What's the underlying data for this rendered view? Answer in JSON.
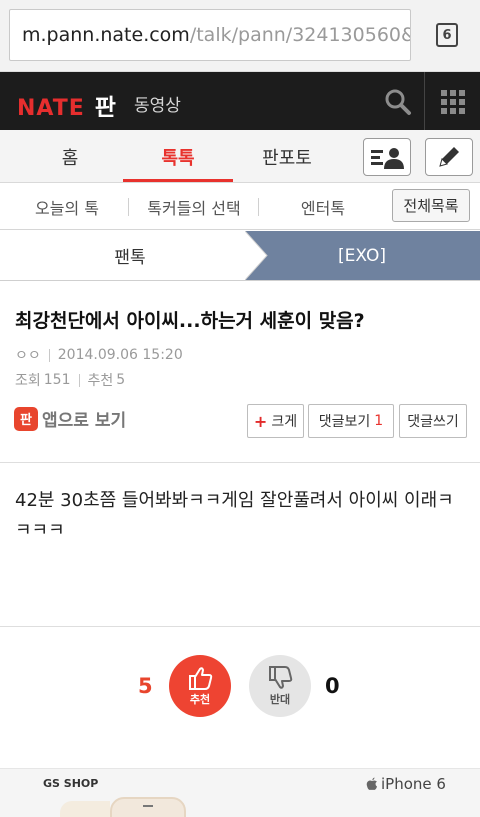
{
  "browser": {
    "url_host": "m.pann.nate.com",
    "url_path": "/talk/pann/324130560&c",
    "tab_count": "6"
  },
  "header": {
    "logo": "NATE",
    "service": "판",
    "video_link": "동영상"
  },
  "tabs": [
    {
      "label": "홈"
    },
    {
      "label": "톡톡"
    },
    {
      "label": "판포토"
    }
  ],
  "subnav": {
    "items": [
      {
        "label": "오늘의 톡"
      },
      {
        "label": "톡커들의 선택"
      },
      {
        "label": "엔터톡"
      }
    ],
    "all_list": "전체목록"
  },
  "breadcrumb": {
    "category": "팬톡",
    "board": "[EXO]"
  },
  "post": {
    "title": "최강천단에서 아이씨...하는거 세훈이 맞음?",
    "author": "ㅇㅇ",
    "date": "2014.09.06 15:20",
    "views_label": "조회",
    "views": "151",
    "recommend_label": "추천",
    "recommend": "5",
    "app_icon_text": "판",
    "app_view": "앱으로 보기",
    "btn_big": "크게",
    "btn_comments": "댓글보기",
    "comments_count": "1",
    "btn_write_comment": "댓글쓰기",
    "body": "42분 30초쯤 들어봐봐ㅋㅋ게임 잘안풀려서 아이씨 이래ㅋㅋㅋㅋ"
  },
  "votes": {
    "up_count": "5",
    "up_label": "추천",
    "down_label": "반대",
    "down_count": "0",
    "up_color": "#ee4432"
  },
  "ad": {
    "brand": "GS SHOP",
    "product": "iPhone 6"
  },
  "colors": {
    "accent": "#e8322d",
    "header_bg": "#1c1c1c",
    "breadcrumb_active": "#6f829f"
  }
}
